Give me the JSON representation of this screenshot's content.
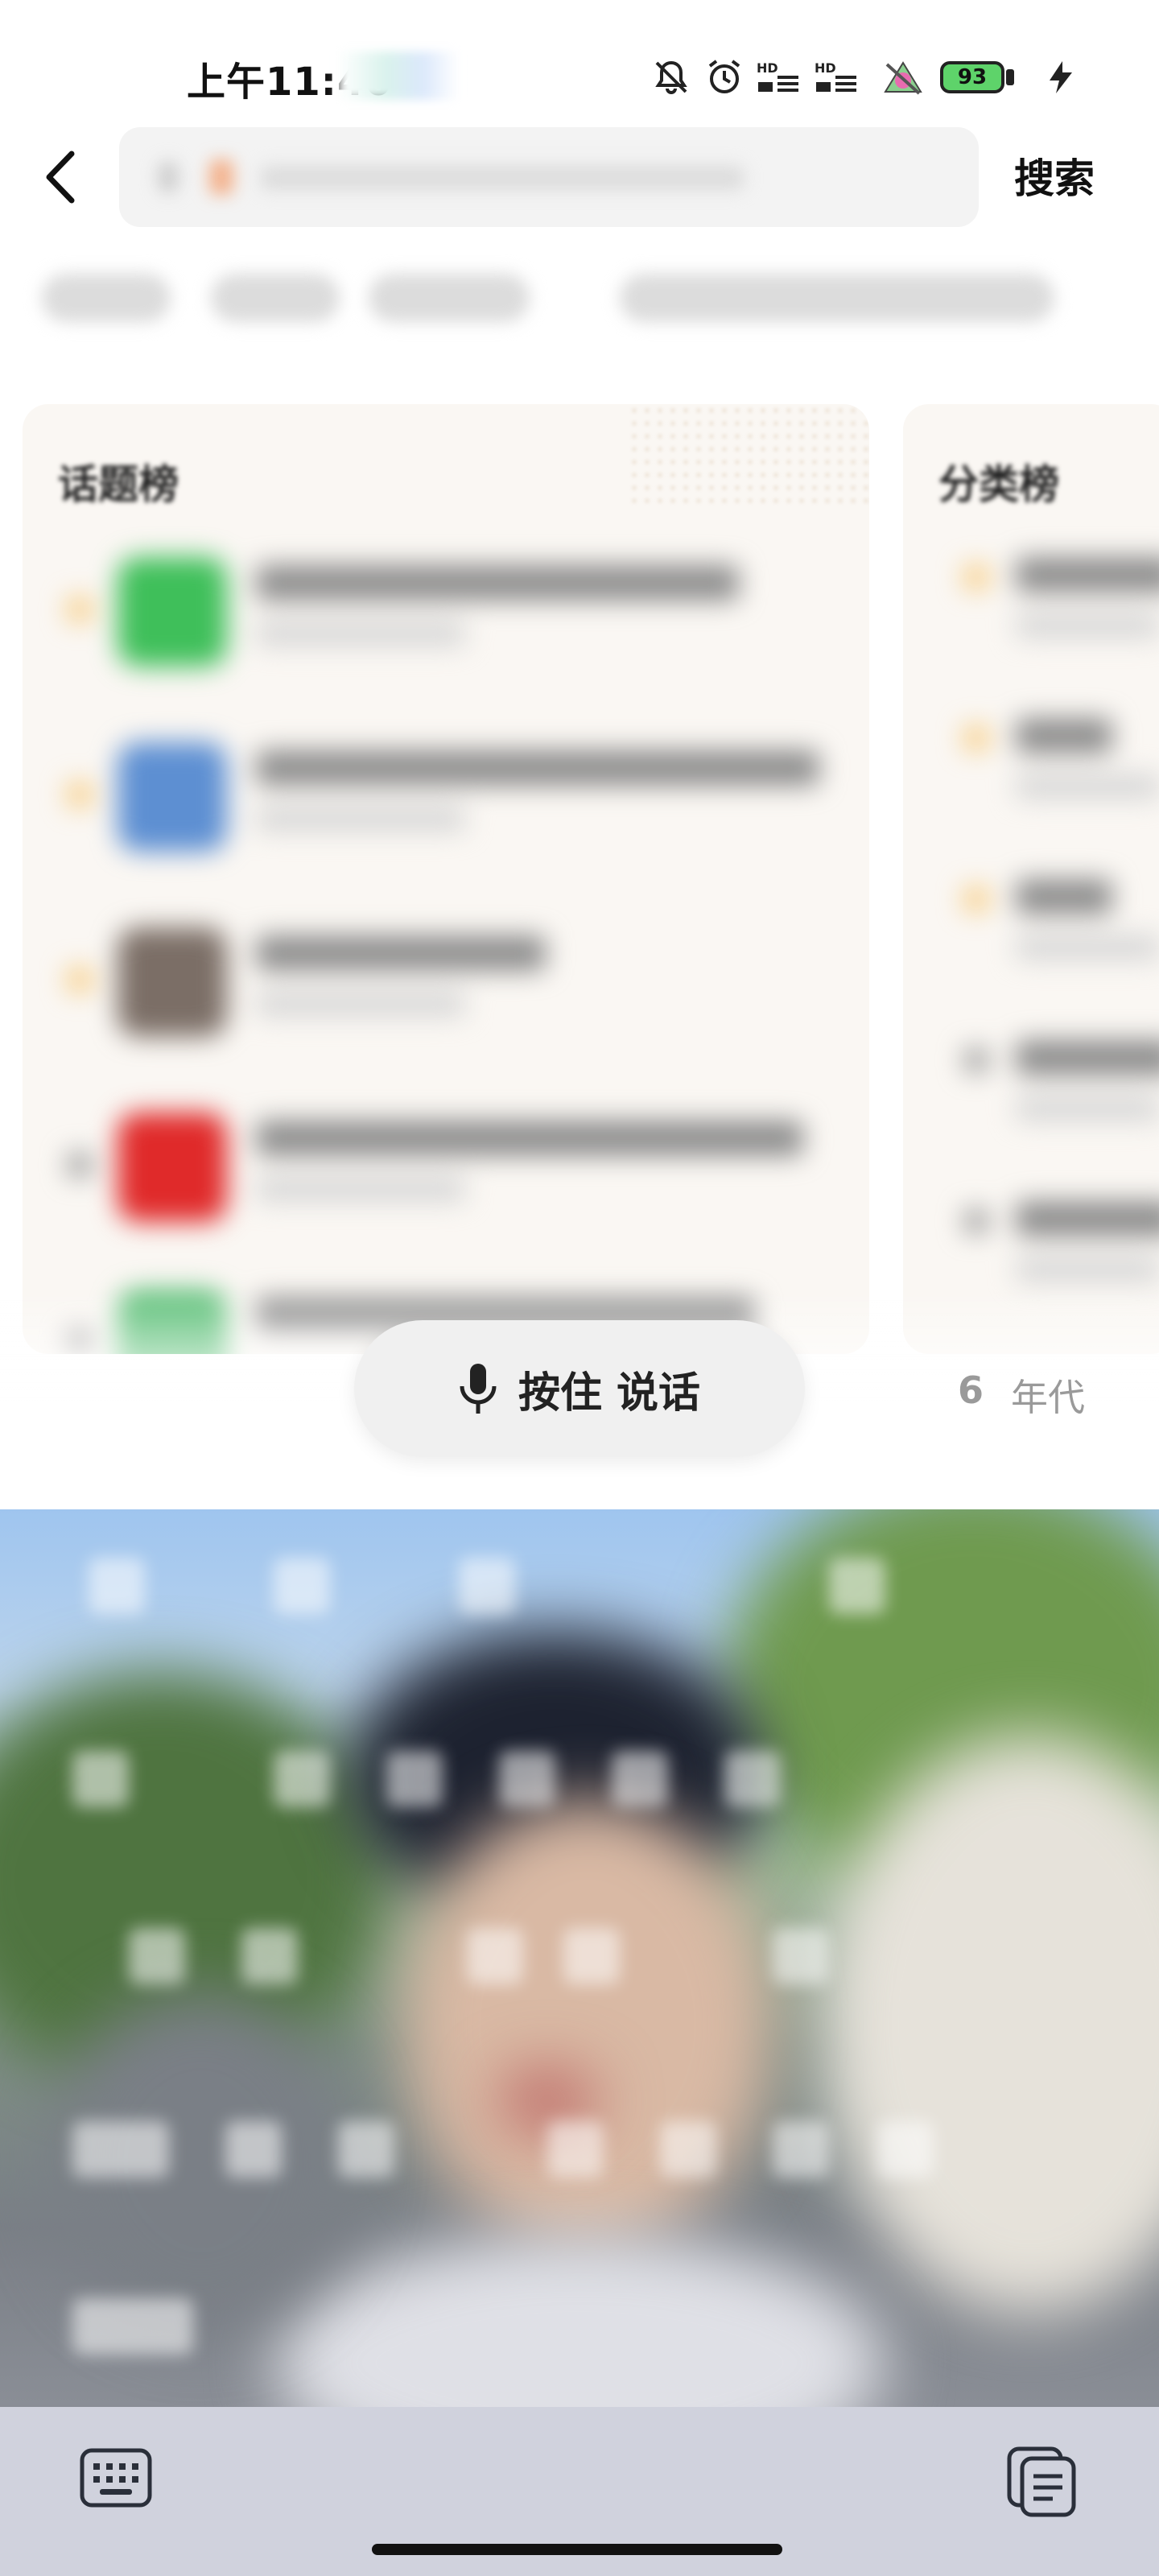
{
  "status_bar": {
    "time": "上午11:40",
    "battery": "93",
    "icons": [
      "bell-muted-icon",
      "alarm-icon",
      "hd-signal-icon",
      "hd-signal-icon",
      "app-notification-icon",
      "battery-icon",
      "charging-icon"
    ]
  },
  "header": {
    "back_icon": "chevron-left-icon",
    "search_label": "搜索",
    "search_placeholder": ""
  },
  "cards": {
    "topic": {
      "title": "话题榜"
    },
    "category": {
      "title": "分类榜"
    }
  },
  "voice": {
    "mic_icon": "microphone-icon",
    "label": "按住 说话"
  },
  "era_tag": {
    "number": "6",
    "label": "年代"
  },
  "bottom_bar": {
    "keyboard_icon": "keyboard-icon",
    "clipboard_icon": "clipboard-icon"
  },
  "colors": {
    "card_background": "#faf7f3",
    "rank_highlight": "#f7c97a",
    "bottom_bar": "#d0d2dd"
  }
}
